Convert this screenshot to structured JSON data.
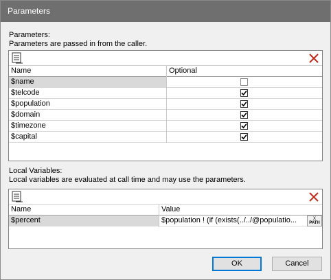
{
  "window": {
    "title": "Parameters"
  },
  "parameters": {
    "heading": "Parameters:",
    "description": "Parameters are passed in from the caller.",
    "columns": {
      "name": "Name",
      "optional": "Optional"
    },
    "rows": [
      {
        "name": "$name",
        "optional": false
      },
      {
        "name": "$telcode",
        "optional": true
      },
      {
        "name": "$population",
        "optional": true
      },
      {
        "name": "$domain",
        "optional": true
      },
      {
        "name": "$timezone",
        "optional": true
      },
      {
        "name": "$capital",
        "optional": true
      }
    ]
  },
  "local_variables": {
    "heading": "Local Variables:",
    "description": "Local variables are evaluated at call time and may use the parameters.",
    "columns": {
      "name": "Name",
      "value": "Value"
    },
    "rows": [
      {
        "name": "$percent",
        "value": "$population ! (if (exists(../../@populatio..."
      }
    ],
    "xpath_button": {
      "line1": "X",
      "line2": "PATH"
    }
  },
  "buttons": {
    "ok": "OK",
    "cancel": "Cancel"
  },
  "icons": {
    "add": "add-row-icon",
    "delete": "delete-icon",
    "check": "checkmark-icon"
  },
  "colors": {
    "delete": "#c42b1c",
    "titlebar": "#6f6f6f",
    "default_button_border": "#0078d7"
  }
}
